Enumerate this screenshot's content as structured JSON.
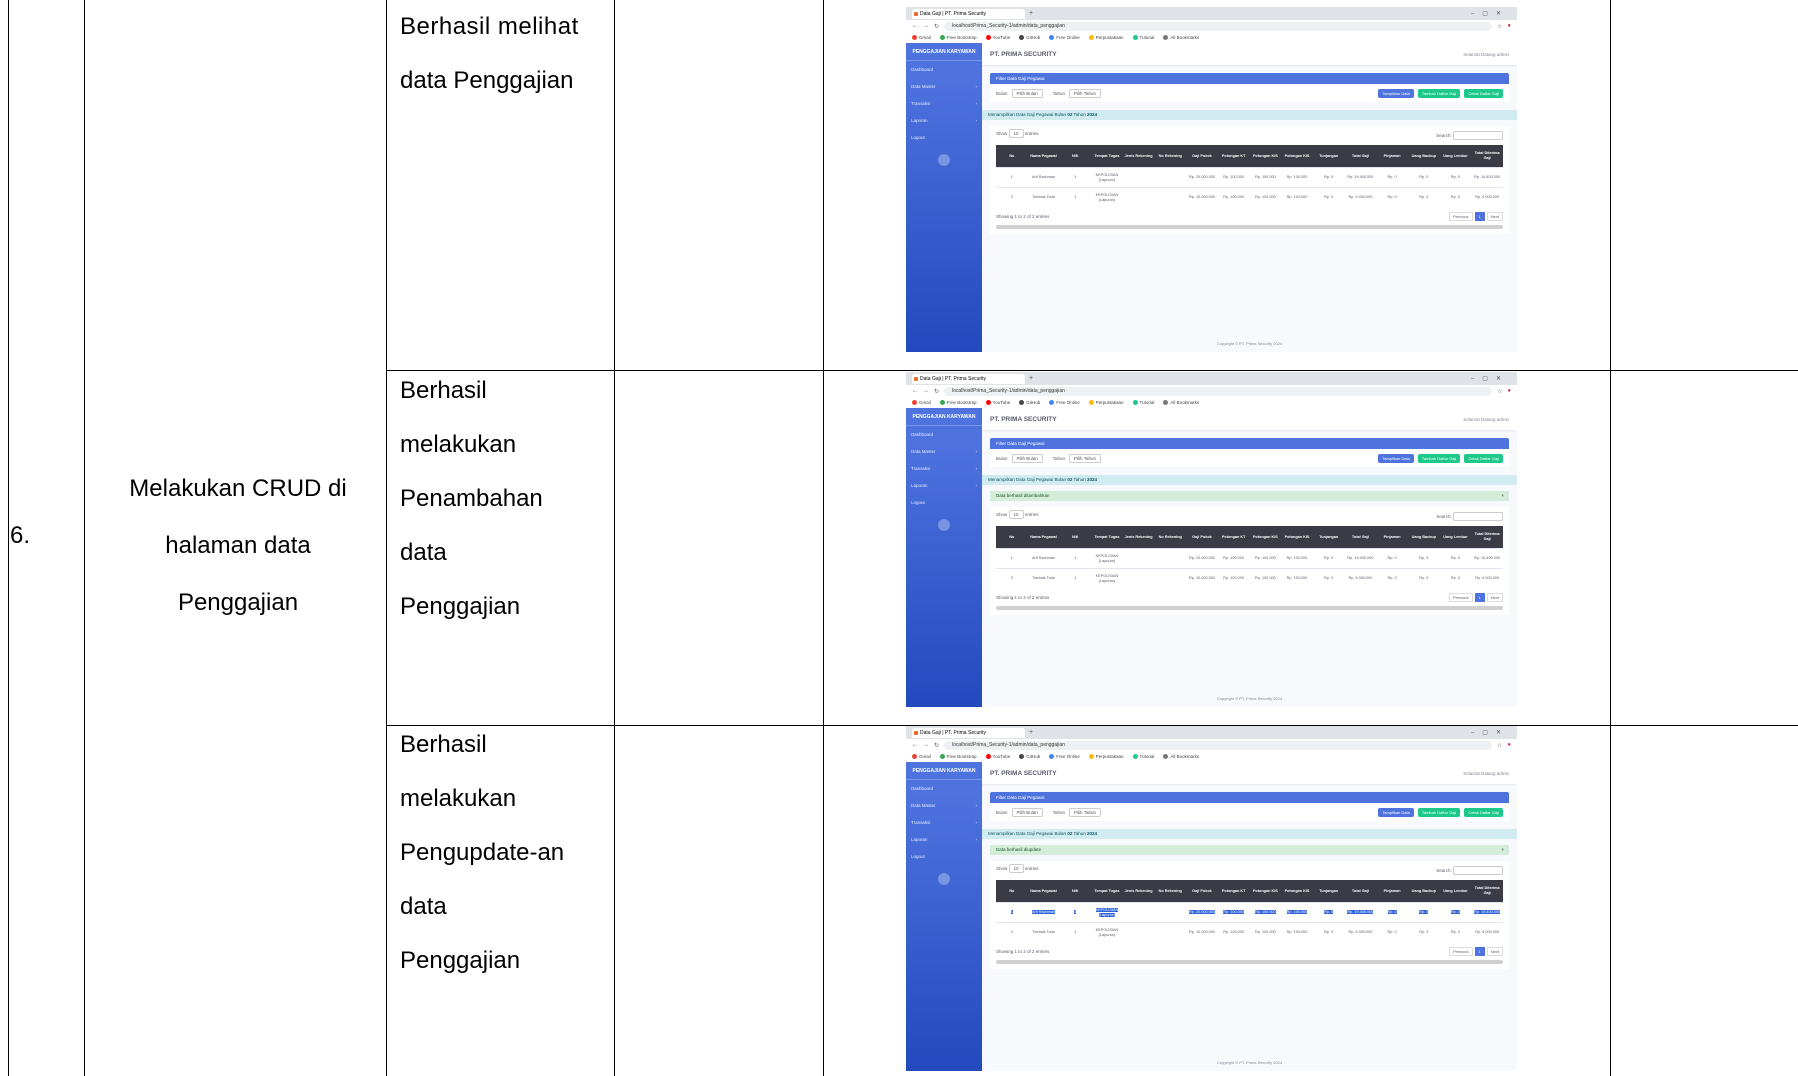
{
  "row": {
    "number": "6.",
    "scenario": [
      "Melakukan CRUD di",
      "halaman data",
      "Penggajian"
    ]
  },
  "results": [
    [
      "Berhasil melihat",
      "data Penggajian"
    ],
    [
      "Berhasil",
      "melakukan",
      "Penambahan",
      "data",
      "Penggajian"
    ],
    [
      "Berhasil",
      "melakukan",
      "Pengupdate-an",
      "data",
      "Penggajian"
    ]
  ],
  "app": {
    "tab_title": "Data Gaji | PT. Prima Security",
    "url_view": "localhost/Prima_Security-1/admin/data_penggajian",
    "url_edit": "localhost/Prima_Security-1/admin/data_penggajian",
    "brand": "PENGGAJIAN KARYAWAN",
    "company": "PT. PRIMA SECURITY",
    "user": "Selamat Datang admin",
    "sidebar": [
      {
        "label": "Dashboard",
        "arrow": ""
      },
      {
        "label": "Data Master",
        "arrow": "›"
      },
      {
        "label": "Transaksi",
        "arrow": "›"
      },
      {
        "label": "Laporan",
        "arrow": "›"
      },
      {
        "label": "Logout",
        "arrow": ""
      }
    ],
    "filter_title": "Filter Data Gaji Pegawai",
    "bulan_label": "Bulan",
    "bulan_value": "Pilih Bulan",
    "tahun_label": "Tahun",
    "tahun_value": "Pilih Tahun",
    "btn_show": "Tampilkan Data",
    "btn_add": "Tambah Daftar Gaji",
    "btn_print": "Cetak Daftar Gaji",
    "info_prefix": "Menampilkan Data Gaji Pegawai Bulan",
    "info_month": "02",
    "info_mid": "Tahun",
    "info_year": "2024",
    "alert_add": "Data berhasil ditambahkan",
    "alert_update": "Data berhasil diupdate",
    "show_label": "Show",
    "show_value": "10",
    "entries_label": "entries",
    "search_label": "Search:",
    "columns": [
      "No",
      "Nama Pegawai",
      "NIK",
      "Tempat Tugas",
      "Jenis Rekening",
      "No Rekening",
      "Gaji Pokok",
      "Potongan KT",
      "Potongan KIS",
      "Potongan KIS",
      "Tunjangan",
      "Total Gaji",
      "Pinjaman",
      "Uang Backup",
      "Uang Lembur",
      "Total Diterima Gaji"
    ],
    "rows": [
      [
        "1",
        "Arif Rachman",
        "1",
        "KEPOLISIAN (Lapuran)",
        "",
        "",
        "Rp. 20.000.000",
        "Rp. 100.000",
        "Rp. 100.000",
        "Rp. 100.000",
        "Rp. 0",
        "Rp. 19.400.000",
        "Rp. 0",
        "Rp. 0",
        "Rp. 0",
        "Rp. 19.400.000"
      ],
      [
        "2",
        "Tombak Toda",
        "1",
        "KEPOLISIAN (Lapuran)",
        "",
        "",
        "Rp. 10.000.000",
        "Rp. 100.000",
        "Rp. 100.000",
        "Rp. 100.000",
        "Rp. 0",
        "Rp. 9.000.000",
        "Rp. 0",
        "Rp. 0",
        "Rp. 0",
        "Rp. 9.000.000"
      ]
    ],
    "showing": "Showing 1 to 2 of 2 entries",
    "prev": "Previous",
    "page": "1",
    "next": "Next",
    "footer": "Copyright © PT. Prima Security 2024"
  }
}
